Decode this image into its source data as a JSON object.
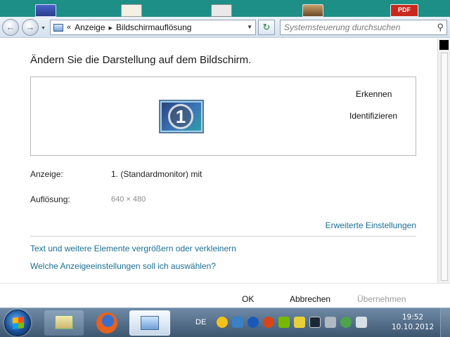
{
  "desktop": {
    "pdf_icon_label": "PDF"
  },
  "address_bar": {
    "history_chevron": "«",
    "breadcrumb": [
      "Anzeige",
      "Bildschirmauflösung"
    ],
    "search_placeholder": "Systemsteuerung durchsuchen"
  },
  "main": {
    "title": "Ändern Sie die Darstellung auf dem Bildschirm.",
    "monitor_number": "1",
    "detect_label": "Erkennen",
    "identify_label": "Identifizieren",
    "display_label": "Anzeige:",
    "display_value": "1. (Standardmonitor) mit",
    "resolution_label": "Auflösung:",
    "resolution_value": "640 × 480",
    "advanced_link": "Erweiterte Einstellungen",
    "links": [
      "Text und weitere Elemente vergrößern oder verkleinern",
      "Welche Anzeigeeinstellungen soll ich auswählen?"
    ]
  },
  "buttons": {
    "ok": "OK",
    "cancel": "Abbrechen",
    "apply": "Übernehmen"
  },
  "taskbar": {
    "language": "DE",
    "time": "19:52",
    "date": "10.10.2012",
    "tray_icons": [
      "emoticon-icon",
      "network-monitor-icon",
      "power-icon",
      "gaming-icon",
      "nvidia-icon",
      "update-icon",
      "steam-icon",
      "volume-icon",
      "network-icon",
      "speaker-icon"
    ]
  },
  "colors": {
    "link": "#1a6f93",
    "desktop": "#1d8f86",
    "taskbar": "#3d5670"
  }
}
